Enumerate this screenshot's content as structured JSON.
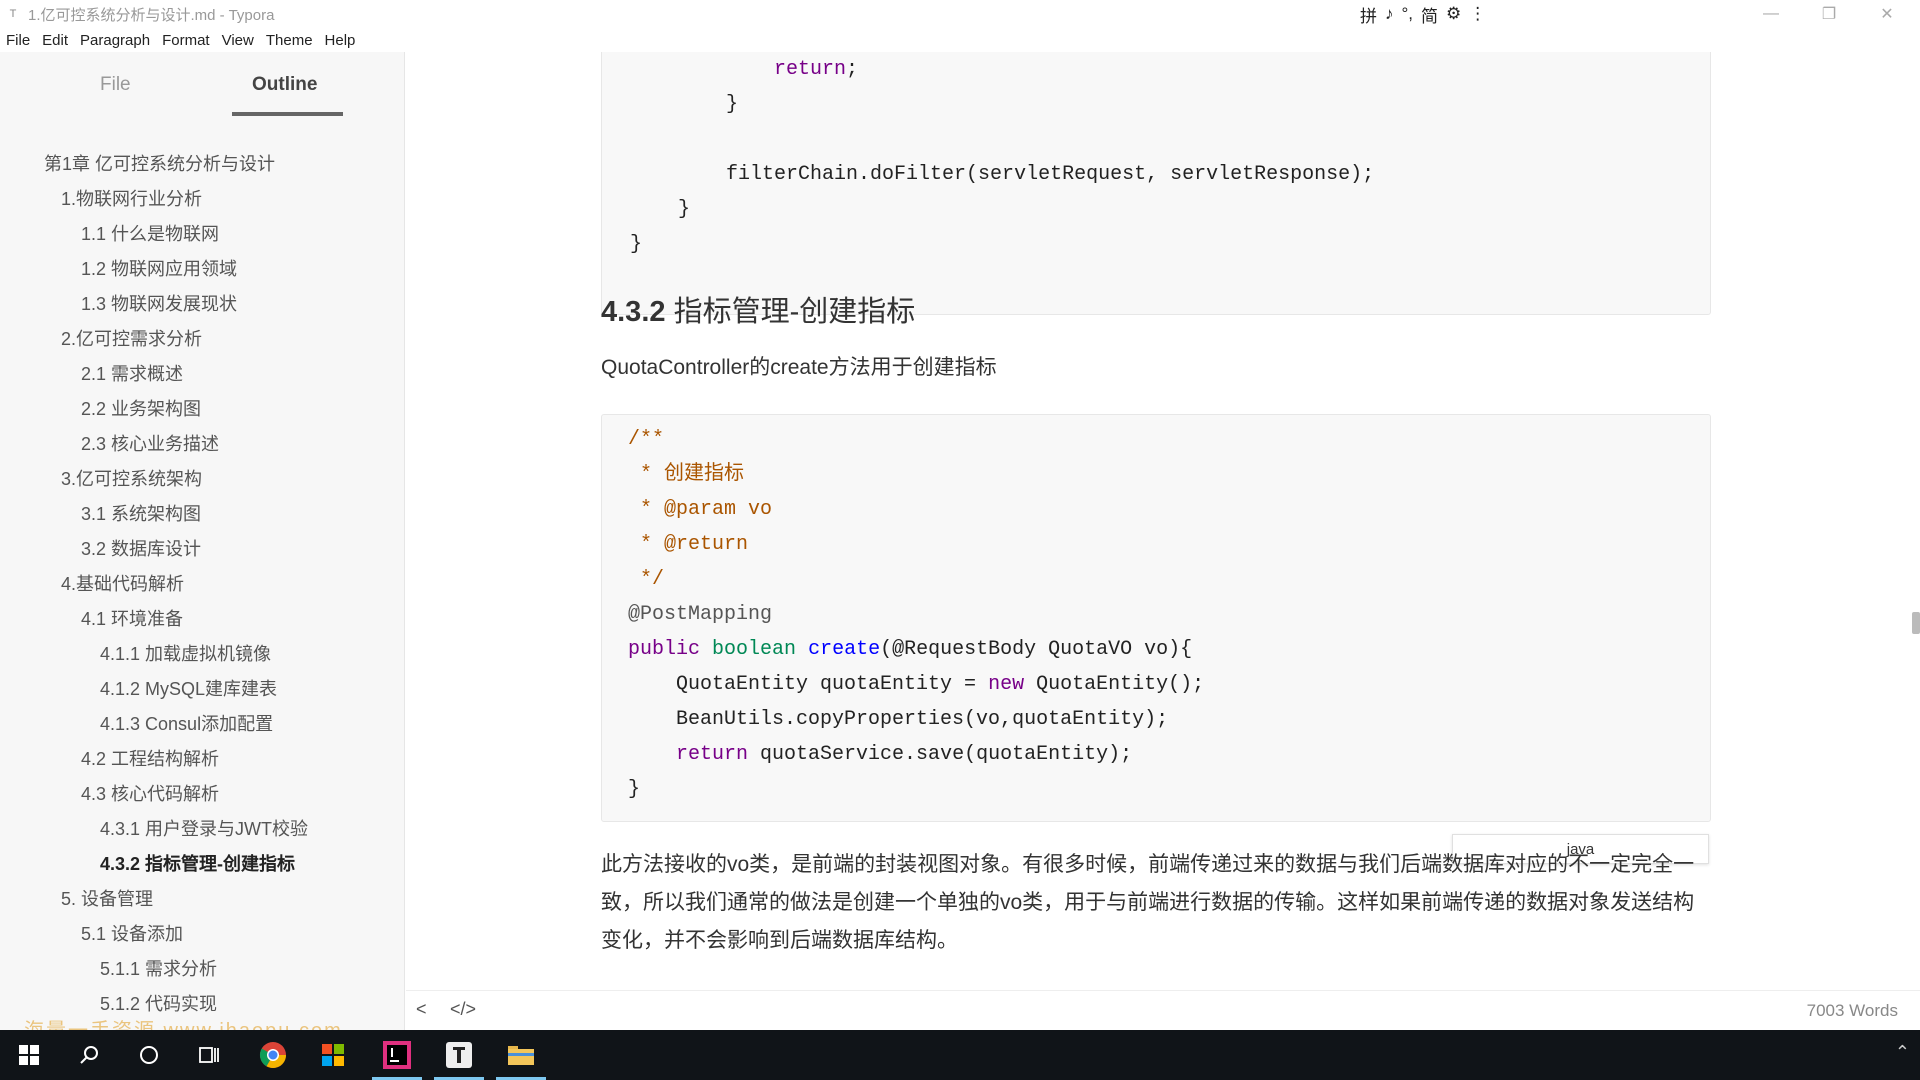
{
  "window": {
    "title": "1.亿可控系统分析与设计.md - Typora",
    "app_icon": "T",
    "ime_toolbar": [
      "拼",
      "♪",
      "°,",
      "简",
      "⚙",
      "⋮"
    ]
  },
  "menu": [
    "File",
    "Edit",
    "Paragraph",
    "Format",
    "View",
    "Theme",
    "Help"
  ],
  "sidebar": {
    "tabs": [
      "File",
      "Outline"
    ],
    "active_tab": "Outline",
    "outline": [
      {
        "label": "第1章 亿可控系统分析与设计",
        "level": 0
      },
      {
        "label": "1.物联网行业分析",
        "level": 1
      },
      {
        "label": "1.1 什么是物联网",
        "level": 2
      },
      {
        "label": "1.2 物联网应用领域",
        "level": 2
      },
      {
        "label": "1.3 物联网发展现状",
        "level": 2
      },
      {
        "label": "2.亿可控需求分析",
        "level": 1
      },
      {
        "label": "2.1 需求概述",
        "level": 2
      },
      {
        "label": "2.2 业务架构图",
        "level": 2
      },
      {
        "label": "2.3 核心业务描述",
        "level": 2
      },
      {
        "label": "3.亿可控系统架构",
        "level": 1
      },
      {
        "label": "3.1 系统架构图",
        "level": 2
      },
      {
        "label": "3.2 数据库设计",
        "level": 2
      },
      {
        "label": "4.基础代码解析",
        "level": 1
      },
      {
        "label": "4.1 环境准备",
        "level": 2
      },
      {
        "label": "4.1.1 加载虚拟机镜像",
        "level": 3
      },
      {
        "label": "4.1.2 MySQL建库建表",
        "level": 3
      },
      {
        "label": "4.1.3 Consul添加配置",
        "level": 3
      },
      {
        "label": "4.2 工程结构解析",
        "level": 2
      },
      {
        "label": "4.3 核心代码解析",
        "level": 2
      },
      {
        "label": "4.3.1 用户登录与JWT校验",
        "level": 3
      },
      {
        "label": "4.3.2 指标管理-创建指标",
        "level": 3,
        "active": true
      },
      {
        "label": "5. 设备管理",
        "level": 1
      },
      {
        "label": "5.1 设备添加",
        "level": 2
      },
      {
        "label": "5.1.1 需求分析",
        "level": 3
      },
      {
        "label": "5.1.2 代码实现",
        "level": 3
      }
    ],
    "watermark": "海量一手资源 www.ihaopu.com"
  },
  "content": {
    "top_code": [
      "            return;",
      "        }",
      "",
      "        filterChain.doFilter(servletRequest, servletResponse);",
      "    }",
      "}"
    ],
    "heading_num": "4.3.2",
    "heading_text": "指标管理-创建指标",
    "intro": "QuotaController的create方法用于创建指标",
    "code_comment": [
      "/**",
      " * 创建指标",
      " * @param vo",
      " * @return",
      " */"
    ],
    "code_anno": "@PostMapping",
    "code_sig": {
      "kw": "public",
      "type": "boolean",
      "name": "create",
      "rest": "(@RequestBody QuotaVO vo){"
    },
    "code_body": [
      "    QuotaEntity quotaEntity = new QuotaEntity();",
      "    BeanUtils.copyProperties(vo,quotaEntity);",
      "    return quotaService.save(quotaEntity);"
    ],
    "code_close": "}",
    "code_language": "java",
    "paragraph": "此方法接收的vo类，是前端的封装视图对象。有很多时候，前端传递过来的数据与我们后端数据库对应的不一定完全一致，所以我们通常的做法是创建一个单独的vo类，用于与前端进行数据的传输。这样如果前端传递的数据对象发送结构变化，并不会影响到后端数据库结构。"
  },
  "footer": {
    "back_icon": "<",
    "source_icon": "</>",
    "word_count": "7003 Words"
  },
  "taskbar": {
    "items": [
      "start-icon",
      "search-icon",
      "cortana-icon",
      "task-view-icon",
      "chrome-icon",
      "store-icon",
      "intellij-icon",
      "typora-icon",
      "explorer-icon"
    ]
  }
}
